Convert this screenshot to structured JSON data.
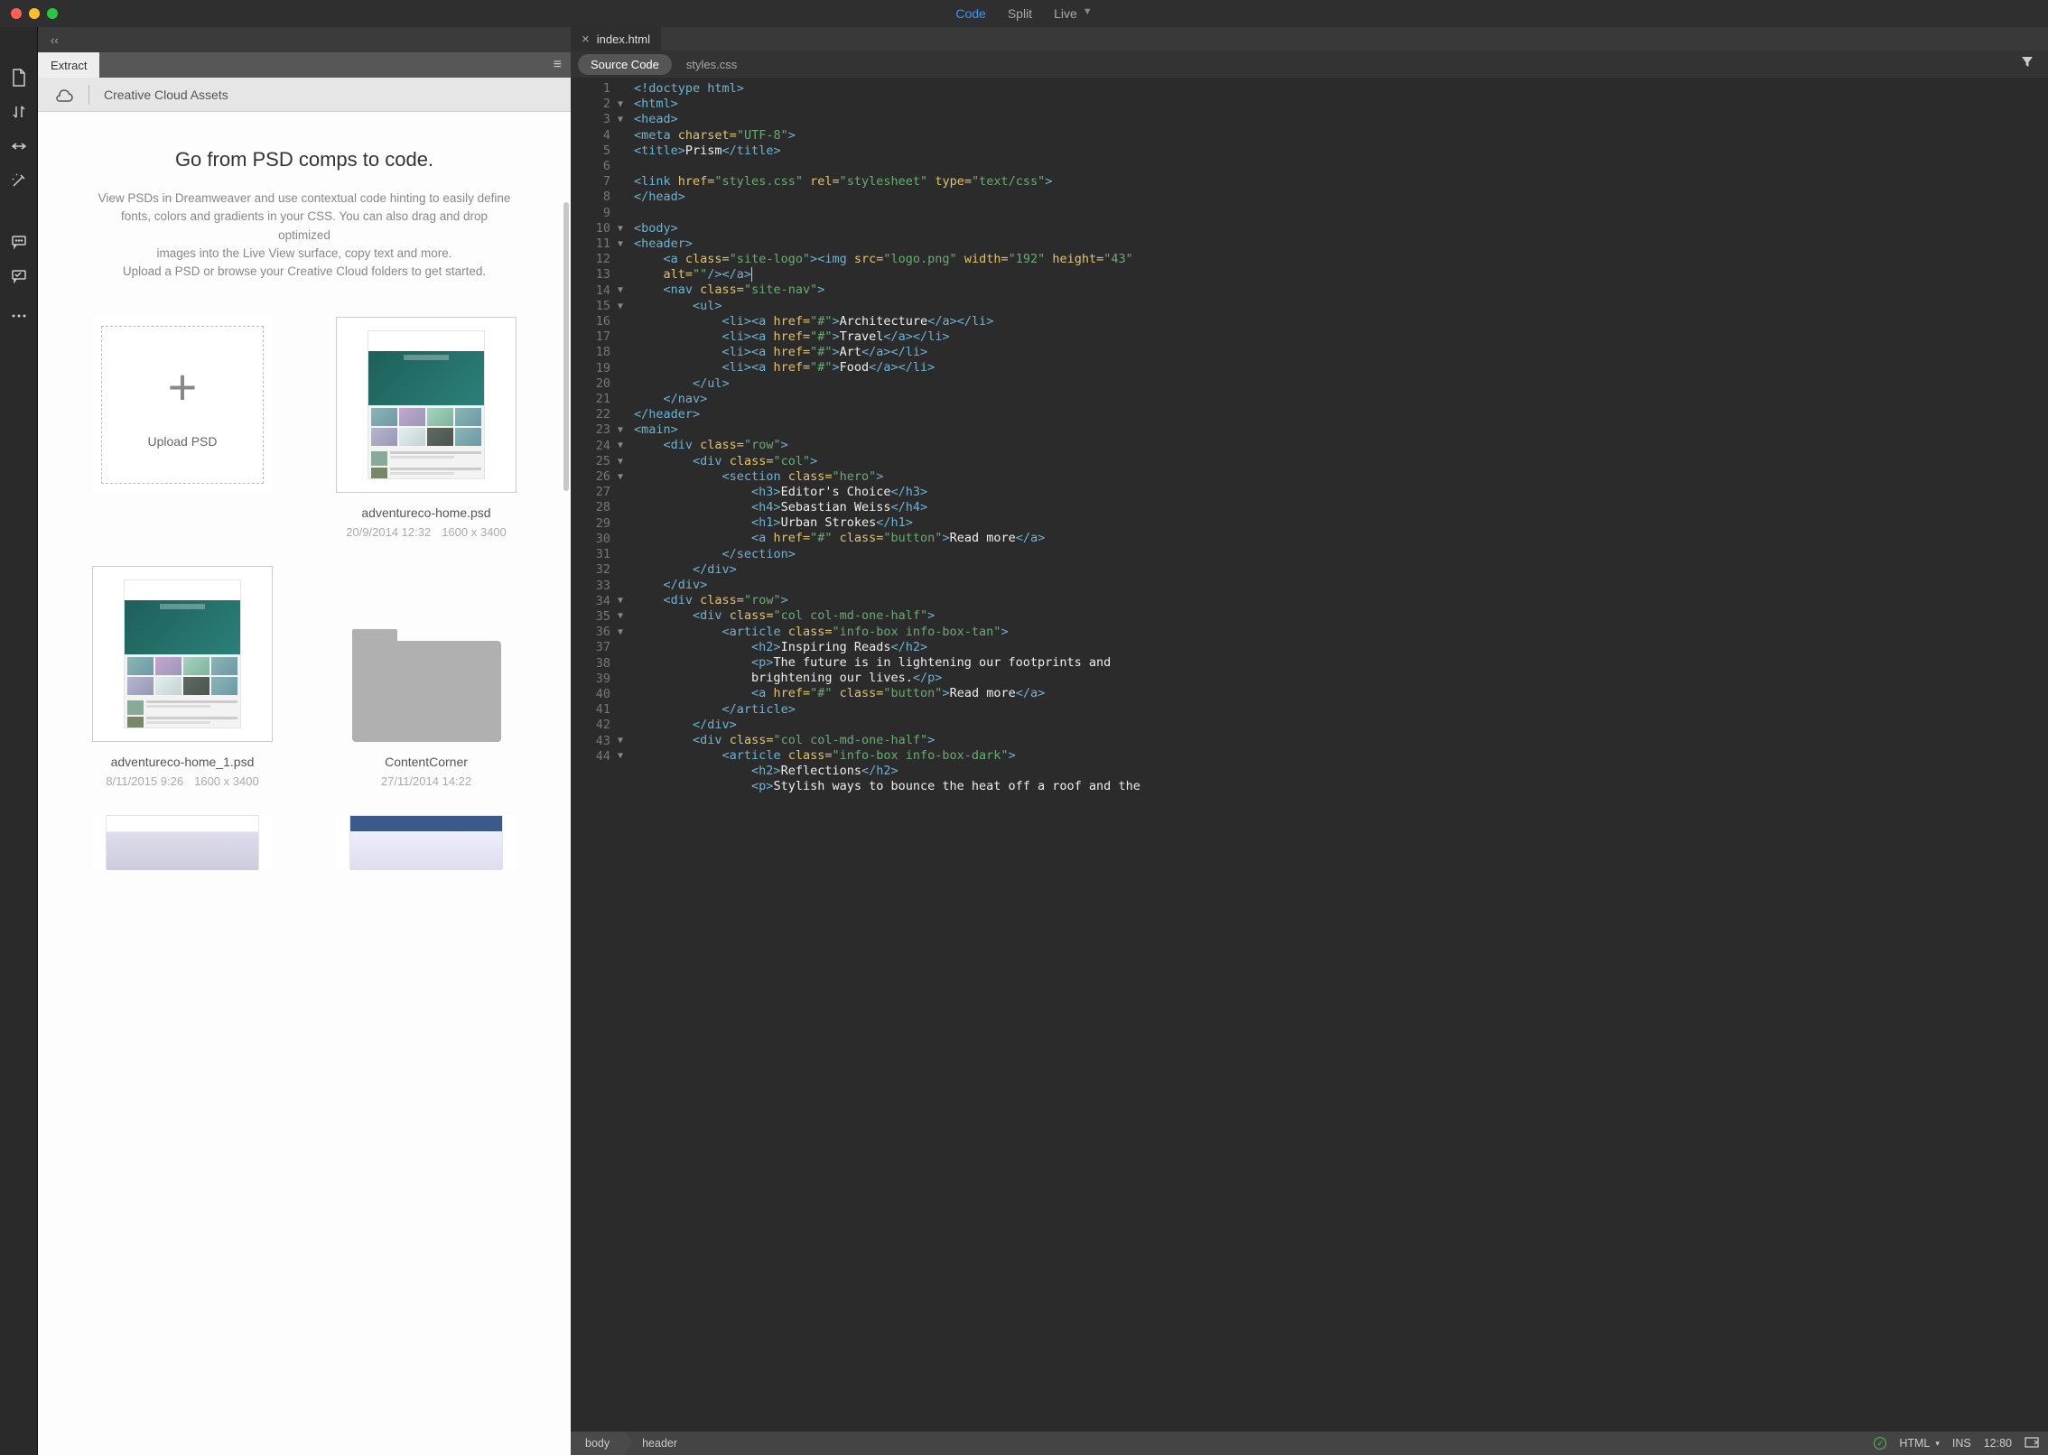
{
  "viewmodes": {
    "code": "Code",
    "split": "Split",
    "live": "Live"
  },
  "leftpanel": {
    "tab": "Extract",
    "cc_label": "Creative Cloud Assets",
    "heading": "Go from PSD comps to code.",
    "desc_l1": "View PSDs in Dreamweaver and use contextual code hinting to easily define",
    "desc_l2": "fonts, colors and gradients in your CSS. You can also drag and drop optimized",
    "desc_l3": "images into the Live View surface, copy text and more.",
    "desc_l4": "Upload a PSD or browse your Creative Cloud folders to get started.",
    "upload_label": "Upload PSD",
    "cards": [
      {
        "name": "adventureco-home.psd",
        "date": "20/9/2014 12:32",
        "dims": "1600 x 3400"
      },
      {
        "name": "adventureco-home_1.psd",
        "date": "8/11/2015 9:26",
        "dims": "1600 x 3400"
      },
      {
        "name": "ContentCorner",
        "date": "27/11/2014 14:22"
      }
    ]
  },
  "editor": {
    "file_tab": "index.html",
    "src_tabs": {
      "source": "Source Code",
      "styles": "styles.css"
    }
  },
  "code_lines": [
    {
      "n": 1,
      "h": "<span class='t-tag'>&lt;!doctype html&gt;</span>"
    },
    {
      "n": 2,
      "f": "▼",
      "h": "<span class='t-tag'>&lt;html&gt;</span>"
    },
    {
      "n": 3,
      "f": "▼",
      "h": "<span class='t-tag'>&lt;head&gt;</span>"
    },
    {
      "n": 4,
      "h": "<span class='t-tag'>&lt;meta</span> <span class='t-attr'>charset=</span><span class='t-str'>\"UTF-8\"</span><span class='t-tag'>&gt;</span>"
    },
    {
      "n": 5,
      "h": "<span class='t-tag'>&lt;title&gt;</span><span class='t-txt'>Prism</span><span class='t-tag'>&lt;/title&gt;</span>"
    },
    {
      "n": 6,
      "h": ""
    },
    {
      "n": 7,
      "h": "<span class='t-tag'>&lt;link</span> <span class='t-attr'>href=</span><span class='t-str'>\"styles.css\"</span> <span class='t-attr'>rel=</span><span class='t-str'>\"stylesheet\"</span> <span class='t-attr'>type=</span><span class='t-str'>\"text/css\"</span><span class='t-tag'>&gt;</span>"
    },
    {
      "n": 8,
      "h": "<span class='t-tag'>&lt;/head&gt;</span>"
    },
    {
      "n": 9,
      "h": ""
    },
    {
      "n": 10,
      "f": "▼",
      "h": "<span class='t-tag'>&lt;body&gt;</span>"
    },
    {
      "n": 11,
      "f": "▼",
      "h": "<span class='t-tag'>&lt;header&gt;</span>"
    },
    {
      "n": 12,
      "h": "    <span class='t-tag'>&lt;a</span> <span class='t-attr'>class=</span><span class='t-str'>\"site-logo\"</span><span class='t-tag'>&gt;&lt;img</span> <span class='t-attr'>src=</span><span class='t-str'>\"logo.png\"</span> <span class='t-attr'>width=</span><span class='t-str'>\"192\"</span> <span class='t-attr'>height=</span><span class='t-str'>\"43\"</span> "
    },
    {
      "n": "",
      "h": "    <span class='t-attr'>alt=</span><span class='t-str'>\"\"</span><span class='t-tag'>/&gt;&lt;/a&gt;</span><span class='cursor-mark'></span>"
    },
    {
      "n": 13,
      "f": "▼",
      "h": "    <span class='t-tag'>&lt;nav</span> <span class='t-attr'>class=</span><span class='t-str'>\"site-nav\"</span><span class='t-tag'>&gt;</span>"
    },
    {
      "n": 14,
      "f": "▼",
      "h": "        <span class='t-tag'>&lt;ul&gt;</span>"
    },
    {
      "n": 15,
      "h": "            <span class='t-tag'>&lt;li&gt;&lt;a</span> <span class='t-attr'>href=</span><span class='t-str'>\"#\"</span><span class='t-tag'>&gt;</span><span class='t-txt'>Architecture</span><span class='t-tag'>&lt;/a&gt;&lt;/li&gt;</span>"
    },
    {
      "n": 16,
      "h": "            <span class='t-tag'>&lt;li&gt;&lt;a</span> <span class='t-attr'>href=</span><span class='t-str'>\"#\"</span><span class='t-tag'>&gt;</span><span class='t-txt'>Travel</span><span class='t-tag'>&lt;/a&gt;&lt;/li&gt;</span>"
    },
    {
      "n": 17,
      "h": "            <span class='t-tag'>&lt;li&gt;&lt;a</span> <span class='t-attr'>href=</span><span class='t-str'>\"#\"</span><span class='t-tag'>&gt;</span><span class='t-txt'>Art</span><span class='t-tag'>&lt;/a&gt;&lt;/li&gt;</span>"
    },
    {
      "n": 18,
      "h": "            <span class='t-tag'>&lt;li&gt;&lt;a</span> <span class='t-attr'>href=</span><span class='t-str'>\"#\"</span><span class='t-tag'>&gt;</span><span class='t-txt'>Food</span><span class='t-tag'>&lt;/a&gt;&lt;/li&gt;</span>"
    },
    {
      "n": 19,
      "h": "        <span class='t-tag'>&lt;/ul&gt;</span>"
    },
    {
      "n": 20,
      "h": "    <span class='t-tag'>&lt;/nav&gt;</span>"
    },
    {
      "n": 21,
      "h": "<span class='t-tag'>&lt;/header&gt;</span>"
    },
    {
      "n": 22,
      "f": "▼",
      "h": "<span class='t-tag'>&lt;main&gt;</span>"
    },
    {
      "n": 23,
      "f": "▼",
      "h": "    <span class='t-tag'>&lt;div</span> <span class='t-attr'>class=</span><span class='t-str'>\"row\"</span><span class='t-tag'>&gt;</span>"
    },
    {
      "n": 24,
      "f": "▼",
      "h": "        <span class='t-tag'>&lt;div</span> <span class='t-attr'>class=</span><span class='t-str'>\"col\"</span><span class='t-tag'>&gt;</span>"
    },
    {
      "n": 25,
      "f": "▼",
      "h": "            <span class='t-tag'>&lt;section</span> <span class='t-attr'>class=</span><span class='t-str'>\"hero\"</span><span class='t-tag'>&gt;</span>"
    },
    {
      "n": 26,
      "h": "                <span class='t-tag'>&lt;h3&gt;</span><span class='t-txt'>Editor's Choice</span><span class='t-tag'>&lt;/h3&gt;</span>"
    },
    {
      "n": 27,
      "h": "                <span class='t-tag'>&lt;h4&gt;</span><span class='t-txt'>Sebastian Weiss</span><span class='t-tag'>&lt;/h4&gt;</span>"
    },
    {
      "n": 28,
      "h": "                <span class='t-tag'>&lt;h1&gt;</span><span class='t-txt'>Urban Strokes</span><span class='t-tag'>&lt;/h1&gt;</span>"
    },
    {
      "n": 29,
      "h": "                <span class='t-tag'>&lt;a</span> <span class='t-attr'>href=</span><span class='t-str'>\"#\"</span> <span class='t-attr'>class=</span><span class='t-str'>\"button\"</span><span class='t-tag'>&gt;</span><span class='t-txt'>Read more</span><span class='t-tag'>&lt;/a&gt;</span>"
    },
    {
      "n": 30,
      "h": "            <span class='t-tag'>&lt;/section&gt;</span>"
    },
    {
      "n": 31,
      "h": "        <span class='t-tag'>&lt;/div&gt;</span>"
    },
    {
      "n": 32,
      "h": "    <span class='t-tag'>&lt;/div&gt;</span>"
    },
    {
      "n": 33,
      "f": "▼",
      "h": "    <span class='t-tag'>&lt;div</span> <span class='t-attr'>class=</span><span class='t-str'>\"row\"</span><span class='t-tag'>&gt;</span>"
    },
    {
      "n": 34,
      "f": "▼",
      "h": "        <span class='t-tag'>&lt;div</span> <span class='t-attr'>class=</span><span class='t-str'>\"col col-md-one-half\"</span><span class='t-tag'>&gt;</span>"
    },
    {
      "n": 35,
      "f": "▼",
      "h": "            <span class='t-tag'>&lt;article</span> <span class='t-attr'>class=</span><span class='t-str'>\"info-box info-box-tan\"</span><span class='t-tag'>&gt;</span>"
    },
    {
      "n": 36,
      "h": "                <span class='t-tag'>&lt;h2&gt;</span><span class='t-txt'>Inspiring Reads</span><span class='t-tag'>&lt;/h2&gt;</span>"
    },
    {
      "n": 37,
      "h": "                <span class='t-tag'>&lt;p&gt;</span><span class='t-txt'>The future is in lightening our footprints and </span>"
    },
    {
      "n": "",
      "h": "                <span class='t-txt'>brightening our lives.</span><span class='t-tag'>&lt;/p&gt;</span>"
    },
    {
      "n": 38,
      "h": "                <span class='t-tag'>&lt;a</span> <span class='t-attr'>href=</span><span class='t-str'>\"#\"</span> <span class='t-attr'>class=</span><span class='t-str'>\"button\"</span><span class='t-tag'>&gt;</span><span class='t-txt'>Read more</span><span class='t-tag'>&lt;/a&gt;</span>"
    },
    {
      "n": 39,
      "h": "            <span class='t-tag'>&lt;/article&gt;</span>"
    },
    {
      "n": 40,
      "h": "        <span class='t-tag'>&lt;/div&gt;</span>"
    },
    {
      "n": 41,
      "f": "▼",
      "h": "        <span class='t-tag'>&lt;div</span> <span class='t-attr'>class=</span><span class='t-str'>\"col col-md-one-half\"</span><span class='t-tag'>&gt;</span>"
    },
    {
      "n": 42,
      "f": "▼",
      "h": "            <span class='t-tag'>&lt;article</span> <span class='t-attr'>class=</span><span class='t-str'>\"info-box info-box-dark\"</span><span class='t-tag'>&gt;</span>"
    },
    {
      "n": 43,
      "h": "                <span class='t-tag'>&lt;h2&gt;</span><span class='t-txt'>Reflections</span><span class='t-tag'>&lt;/h2&gt;</span>"
    },
    {
      "n": 44,
      "h": "                <span class='t-tag'>&lt;p&gt;</span><span class='t-txt'>Stylish ways to bounce the heat off a roof and the </span>"
    }
  ],
  "status": {
    "crumb1": "body",
    "crumb2": "header",
    "lang": "HTML",
    "ins": "INS",
    "pos": "12:80"
  }
}
